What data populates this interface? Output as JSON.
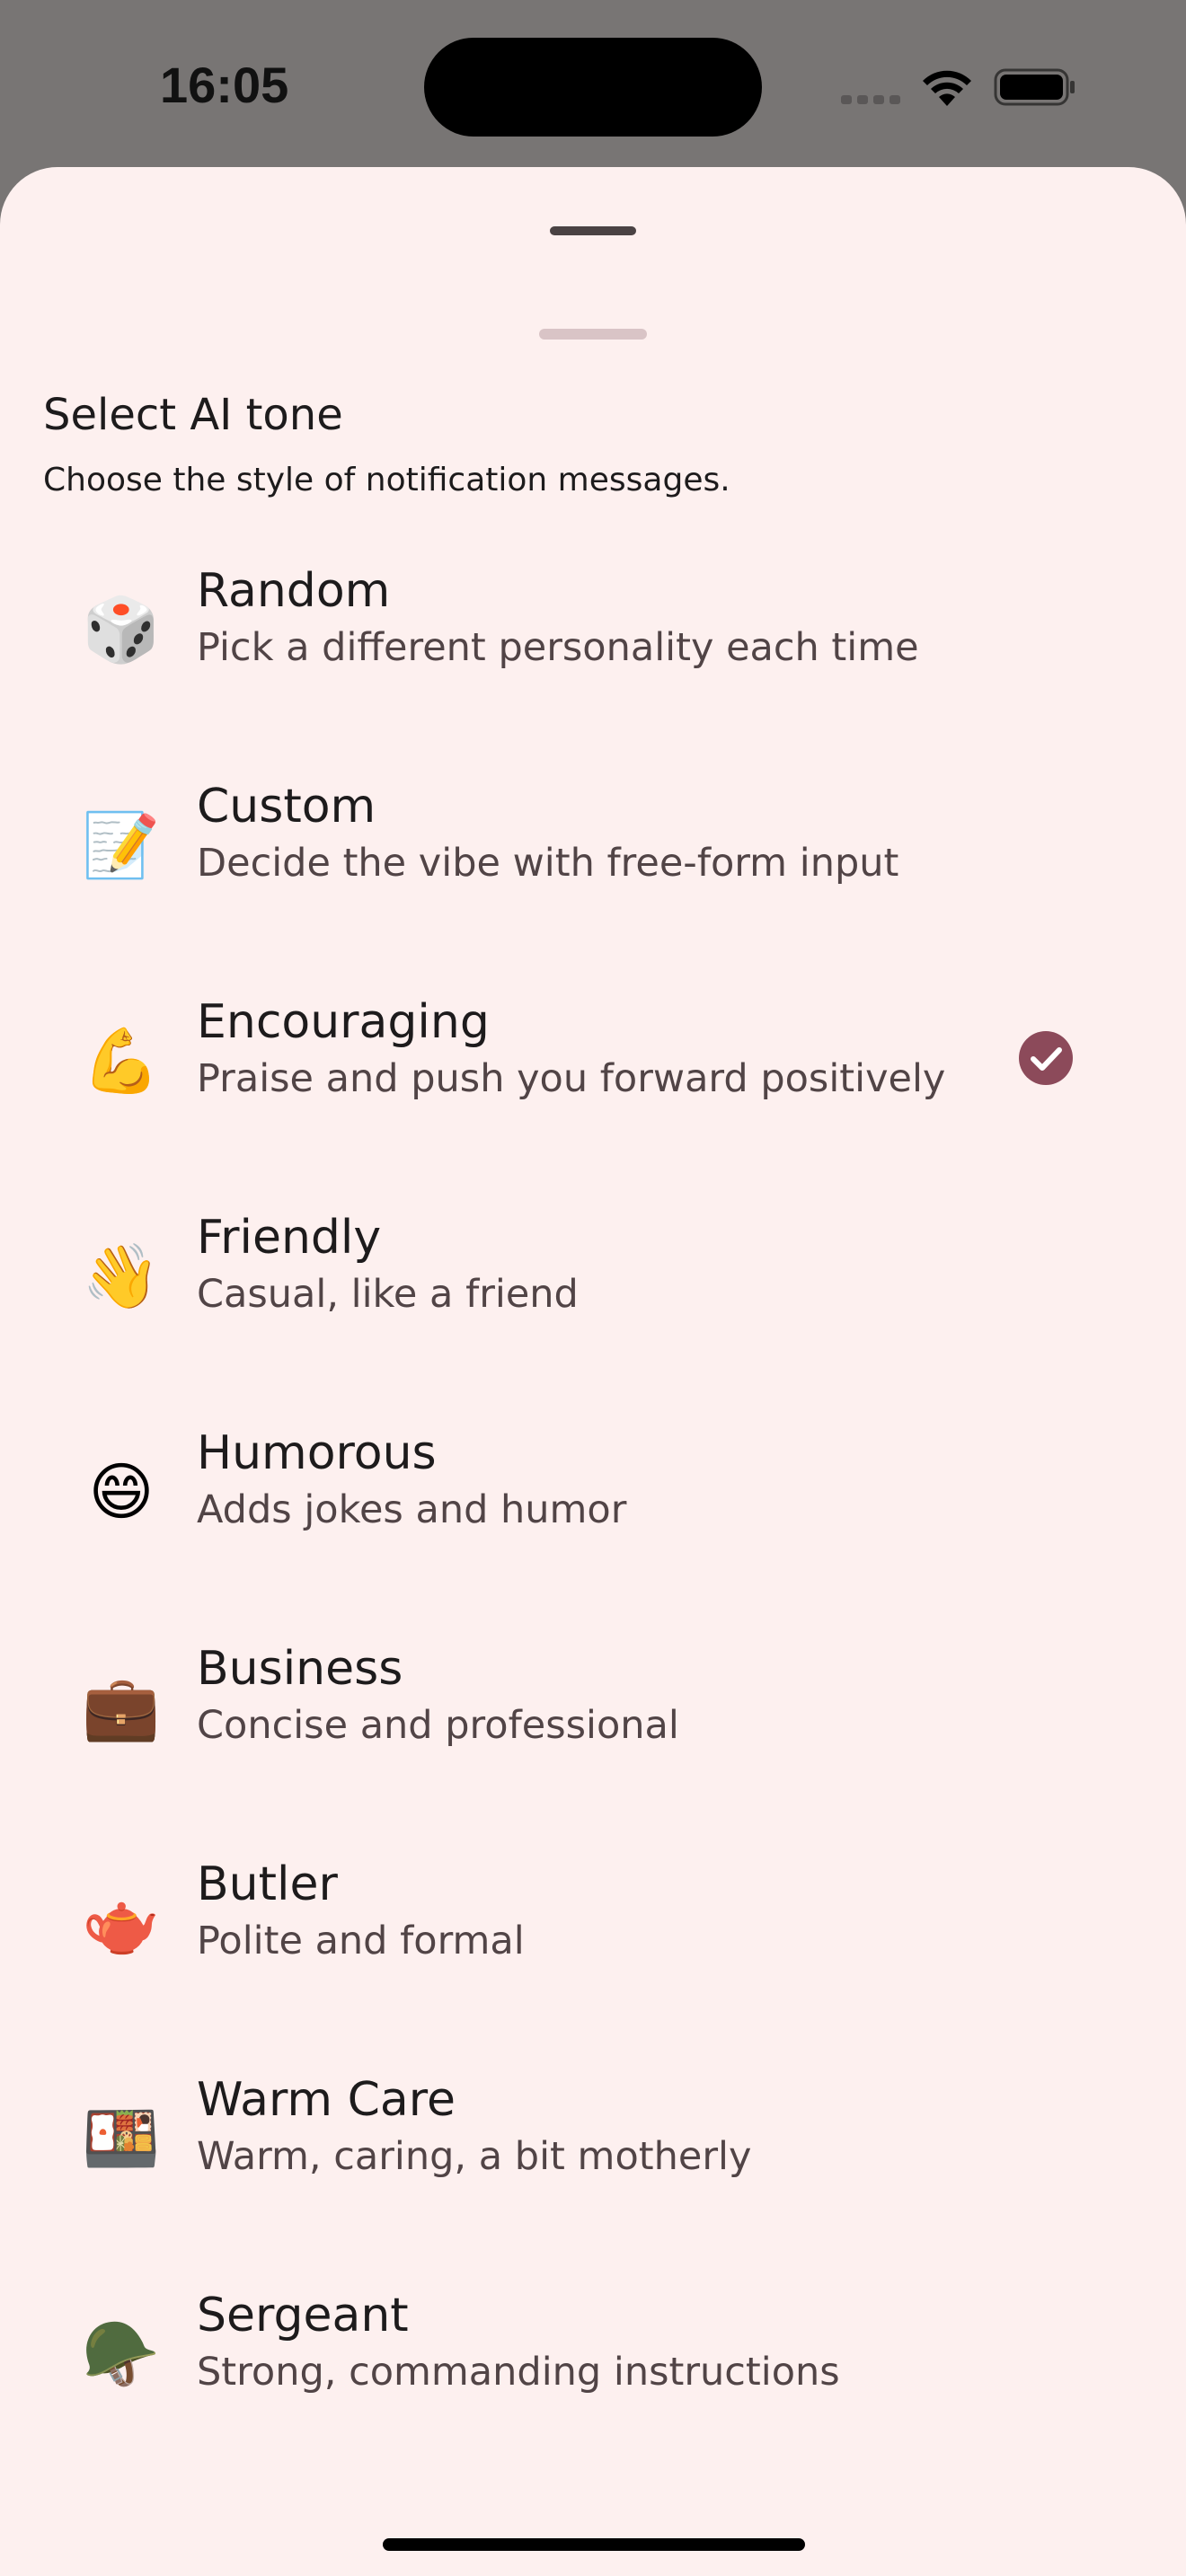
{
  "status_bar": {
    "time": "16:05"
  },
  "sheet": {
    "title": "Select AI tone",
    "subtitle": "Choose the style of notification messages."
  },
  "tones": [
    {
      "emoji": "🎲",
      "icon": "die-icon",
      "name": "Random",
      "description": "Pick a different personality each time",
      "selected": false
    },
    {
      "emoji": "📝",
      "icon": "memo-icon",
      "name": "Custom",
      "description": "Decide the vibe with free-form input",
      "selected": false
    },
    {
      "emoji": "💪",
      "icon": "flexed-biceps-icon",
      "name": "Encouraging",
      "description": "Praise and push you forward positively",
      "selected": true
    },
    {
      "emoji": "👋",
      "icon": "waving-hand-icon",
      "name": "Friendly",
      "description": "Casual, like a friend",
      "selected": false
    },
    {
      "emoji": "😄",
      "icon": "grinning-face-icon",
      "name": "Humorous",
      "description": "Adds jokes and humor",
      "selected": false
    },
    {
      "emoji": "💼",
      "icon": "briefcase-icon",
      "name": "Business",
      "description": "Concise and professional",
      "selected": false
    },
    {
      "emoji": "🫖",
      "icon": "teapot-icon",
      "name": "Butler",
      "description": "Polite and formal",
      "selected": false
    },
    {
      "emoji": "🍱",
      "icon": "bento-box-icon",
      "name": "Warm Care",
      "description": "Warm, caring, a bit motherly",
      "selected": false
    },
    {
      "emoji": "🪖",
      "icon": "military-helmet-icon",
      "name": "Sergeant",
      "description": "Strong, commanding instructions",
      "selected": false
    }
  ],
  "colors": {
    "sheet_background": "#fdf0ef",
    "accent": "#8c4a5a",
    "text_primary": "#1d1b1c",
    "text_secondary": "#514446",
    "scrim": "#787574"
  }
}
